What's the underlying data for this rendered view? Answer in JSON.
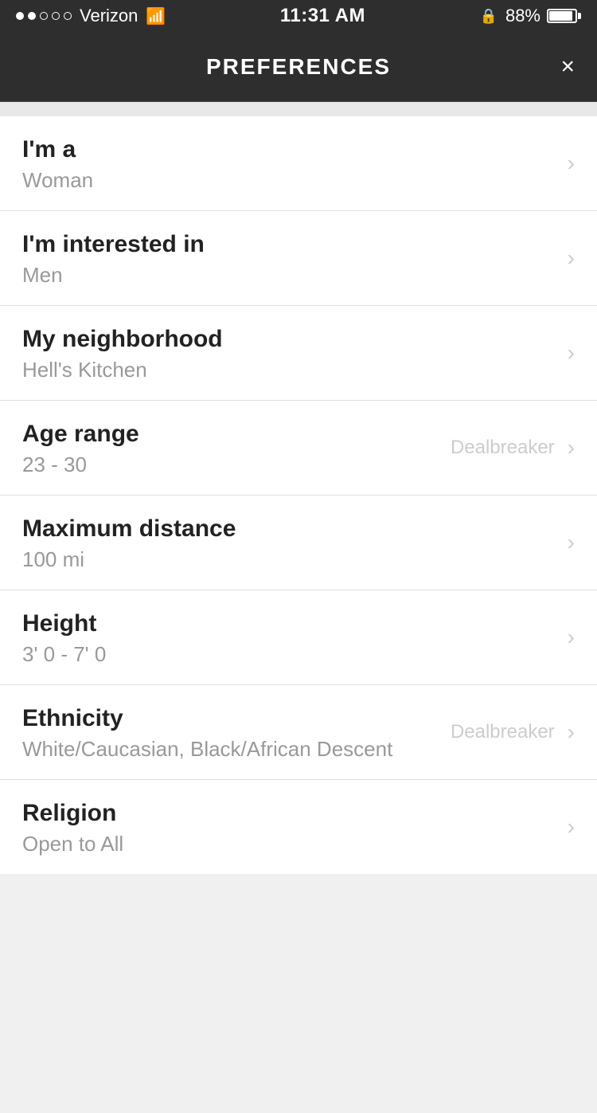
{
  "statusBar": {
    "carrier": "Verizon",
    "time": "11:31 AM",
    "battery": "88%",
    "lockIcon": "🔒"
  },
  "navBar": {
    "title": "PREFERENCES",
    "closeLabel": "×"
  },
  "preferences": [
    {
      "id": "im-a",
      "label": "I'm a",
      "value": "Woman",
      "hasDealbreaker": false,
      "dealbreaker": ""
    },
    {
      "id": "interested-in",
      "label": "I'm interested in",
      "value": "Men",
      "hasDealbreaker": false,
      "dealbreaker": ""
    },
    {
      "id": "neighborhood",
      "label": "My neighborhood",
      "value": "Hell's Kitchen",
      "hasDealbreaker": false,
      "dealbreaker": ""
    },
    {
      "id": "age-range",
      "label": "Age range",
      "value": "23 - 30",
      "hasDealbreaker": true,
      "dealbreaker": "Dealbreaker"
    },
    {
      "id": "max-distance",
      "label": "Maximum distance",
      "value": "100 mi",
      "hasDealbreaker": false,
      "dealbreaker": ""
    },
    {
      "id": "height",
      "label": "Height",
      "value": "3' 0 - 7' 0",
      "hasDealbreaker": false,
      "dealbreaker": ""
    },
    {
      "id": "ethnicity",
      "label": "Ethnicity",
      "value": "White/Caucasian, Black/African Descent",
      "hasDealbreaker": true,
      "dealbreaker": "Dealbreaker"
    },
    {
      "id": "religion",
      "label": "Religion",
      "value": "Open to All",
      "hasDealbreaker": false,
      "dealbreaker": ""
    }
  ]
}
